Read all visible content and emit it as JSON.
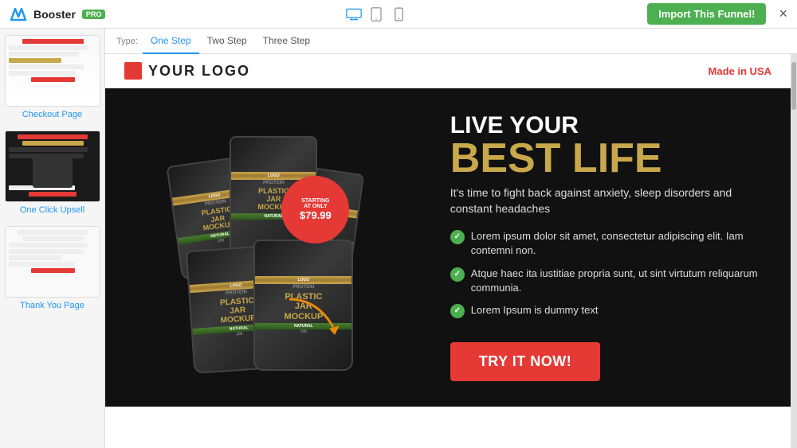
{
  "topbar": {
    "brand": "Booster",
    "pro_label": "PRO",
    "import_btn": "Import This Funnel!",
    "close_label": "×"
  },
  "devices": [
    {
      "name": "desktop",
      "active": true
    },
    {
      "name": "tablet",
      "active": false
    },
    {
      "name": "mobile",
      "active": false
    }
  ],
  "tabs": {
    "type_label": "Type:",
    "items": [
      {
        "label": "One Step",
        "active": true
      },
      {
        "label": "Two Step",
        "active": false
      },
      {
        "label": "Three Step",
        "active": false
      }
    ]
  },
  "sidebar": {
    "items": [
      {
        "label": "Checkout Page"
      },
      {
        "label": "One Click Upsell"
      },
      {
        "label": "Thank You Page"
      }
    ]
  },
  "preview": {
    "logo_text": "YOUR LOGO",
    "made_in_usa": "Made in USA",
    "headline_top": "LIVE YOUR",
    "headline_main": "BEST LIFE",
    "subtitle": "It's time to fight back against anxiety, sleep disorders and constant headaches",
    "features": [
      "Lorem ipsum dolor sit amet, consectetur adipiscing elit. Iam contemni non.",
      "Atque haec ita iustitiae propria sunt, ut sint virtutum reliquarum communia.",
      "Lorem Ipsum is dummy text"
    ],
    "price_badge": {
      "line1": "STARTING",
      "line2": "AT ONLY",
      "price": "$79.99"
    },
    "cta_btn": "TRY IT NOW!"
  }
}
